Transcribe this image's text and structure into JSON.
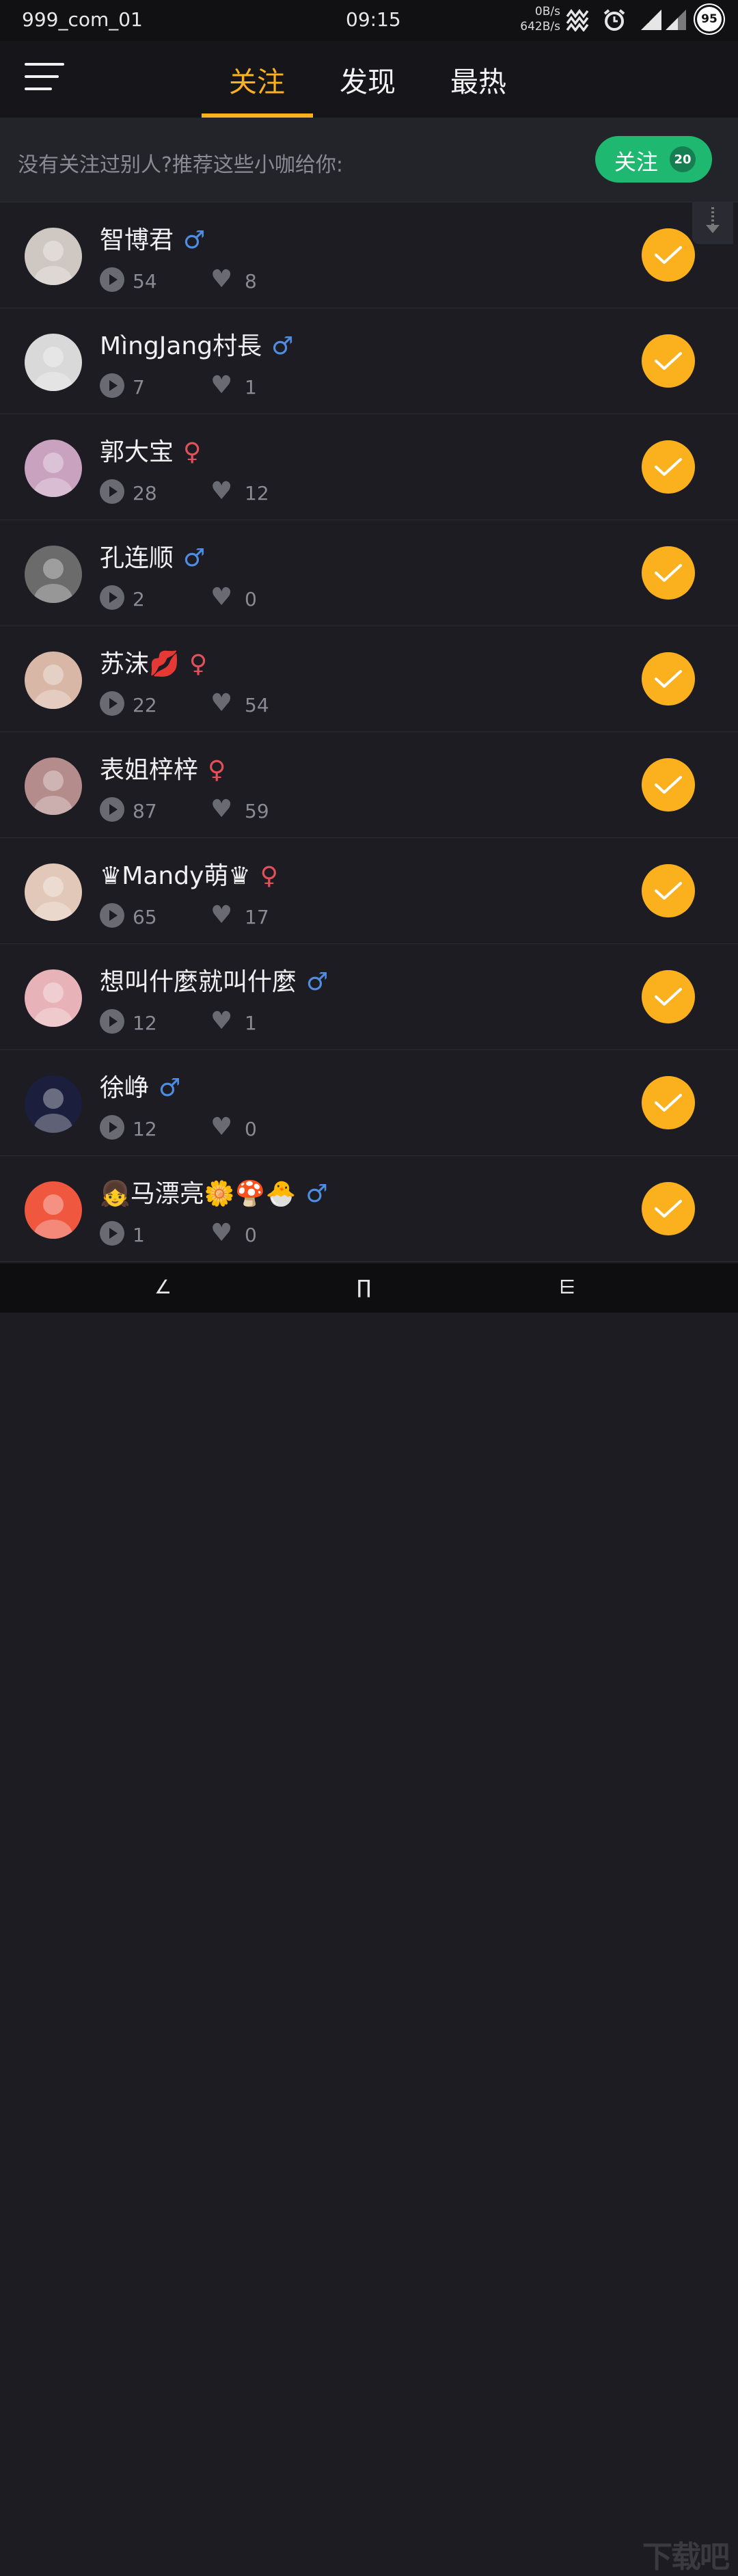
{
  "status_bar": {
    "carrier": "999_com_01",
    "time": "09:15",
    "net_up": "0B/s",
    "net_down": "642B/s",
    "battery": "95"
  },
  "header": {
    "tabs": [
      {
        "label": "关注",
        "active": true
      },
      {
        "label": "发现",
        "active": false
      },
      {
        "label": "最热",
        "active": false
      }
    ]
  },
  "recommend": {
    "text": "没有关注过别人?推荐这些小咖给你:",
    "follow_all_label": "关注",
    "follow_all_count": "20"
  },
  "colors": {
    "accent": "#fbb01e",
    "green": "#1fb871",
    "male": "#4f8de2",
    "female": "#e2505a"
  },
  "users": [
    {
      "name": "智博君",
      "gender": "male",
      "gender_symbol": "♂",
      "plays": "54",
      "likes": "8",
      "avatar_color": "#cfc8c2"
    },
    {
      "name": "MìngJang村長",
      "gender": "male",
      "gender_symbol": "♂",
      "plays": "7",
      "likes": "1",
      "avatar_color": "#d9d9d9"
    },
    {
      "name": "郭大宝",
      "gender": "female",
      "gender_symbol": "♀",
      "plays": "28",
      "likes": "12",
      "avatar_color": "#c9a2c0"
    },
    {
      "name": "孔连顺",
      "gender": "male",
      "gender_symbol": "♂",
      "plays": "2",
      "likes": "0",
      "avatar_color": "#6b6b6b"
    },
    {
      "name": "苏沫💋",
      "gender": "female",
      "gender_symbol": "♀",
      "plays": "22",
      "likes": "54",
      "avatar_color": "#d8b7a6"
    },
    {
      "name": "表姐梓梓",
      "gender": "female",
      "gender_symbol": "♀",
      "plays": "87",
      "likes": "59",
      "avatar_color": "#b58c8c"
    },
    {
      "name": "♛Mandy萌♛",
      "gender": "female",
      "gender_symbol": "♀",
      "plays": "65",
      "likes": "17",
      "avatar_color": "#e2c8b8"
    },
    {
      "name": "想叫什麼就叫什麼",
      "gender": "male",
      "gender_symbol": "♂",
      "plays": "12",
      "likes": "1",
      "avatar_color": "#e8b3b8"
    },
    {
      "name": "徐峥",
      "gender": "male",
      "gender_symbol": "♂",
      "plays": "12",
      "likes": "0",
      "avatar_color": "#1b1f3d"
    },
    {
      "name": "👧马漂亮🌼🍄🐣",
      "gender": "male",
      "gender_symbol": "♂",
      "plays": "1",
      "likes": "0",
      "avatar_color": "#f0573f"
    }
  ],
  "nav": {
    "back": "∠",
    "home": "∏",
    "recent": "⋿"
  },
  "watermark": "下载吧"
}
